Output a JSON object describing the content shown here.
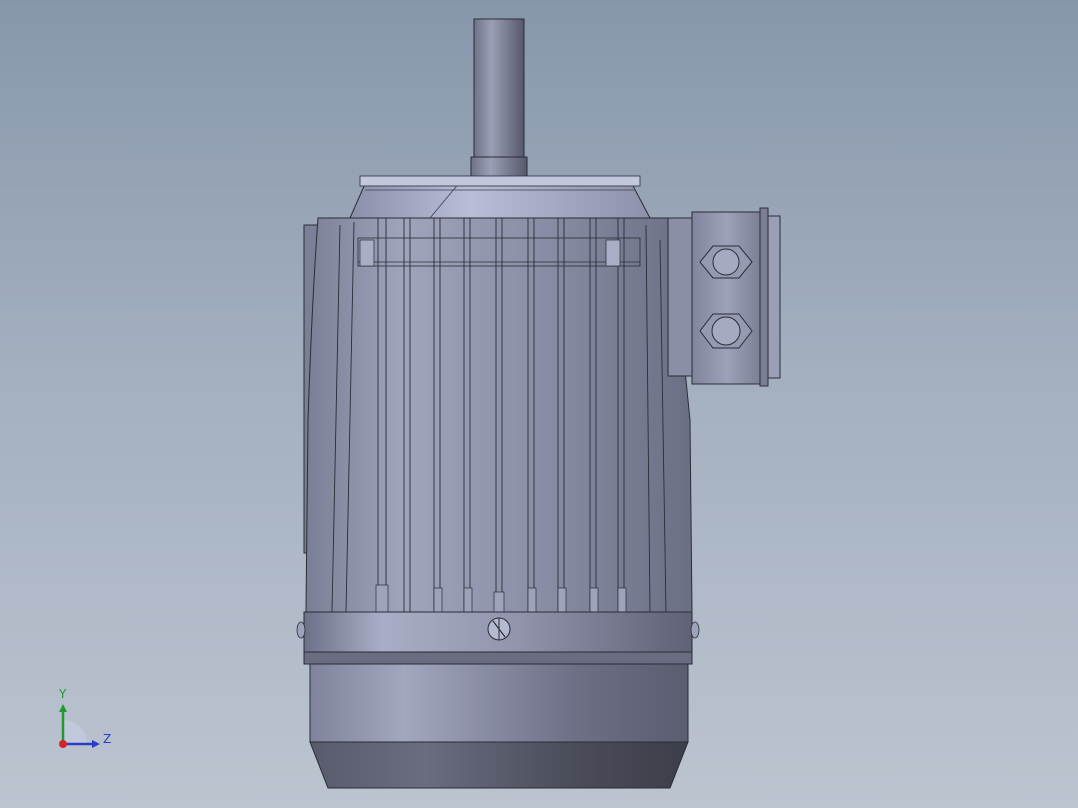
{
  "viewport": {
    "view": "cad-3d-viewport"
  },
  "model": {
    "name": "motor"
  },
  "triad": {
    "y_label": "Y",
    "z_label": "Z",
    "colors": {
      "x": "#d4242a",
      "y": "#1f9a2e",
      "z": "#2a3cc8"
    }
  }
}
